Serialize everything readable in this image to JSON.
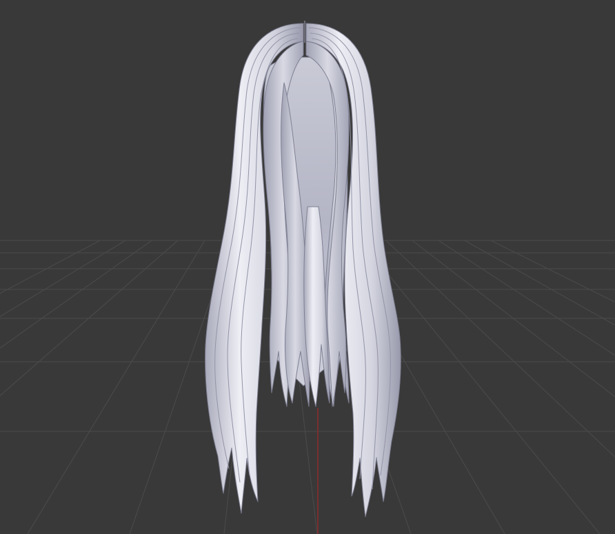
{
  "viewport": {
    "background": "#393939",
    "grid_color": "#4a4a4a",
    "axis_color": "#8a2a2a",
    "object": "hair-mesh"
  },
  "colors": {
    "hair_light": "#eeeef5",
    "hair_mid": "#c5c6d4",
    "hair_shadow": "#8e8fa0",
    "hair_edge": "#7e7f92"
  }
}
